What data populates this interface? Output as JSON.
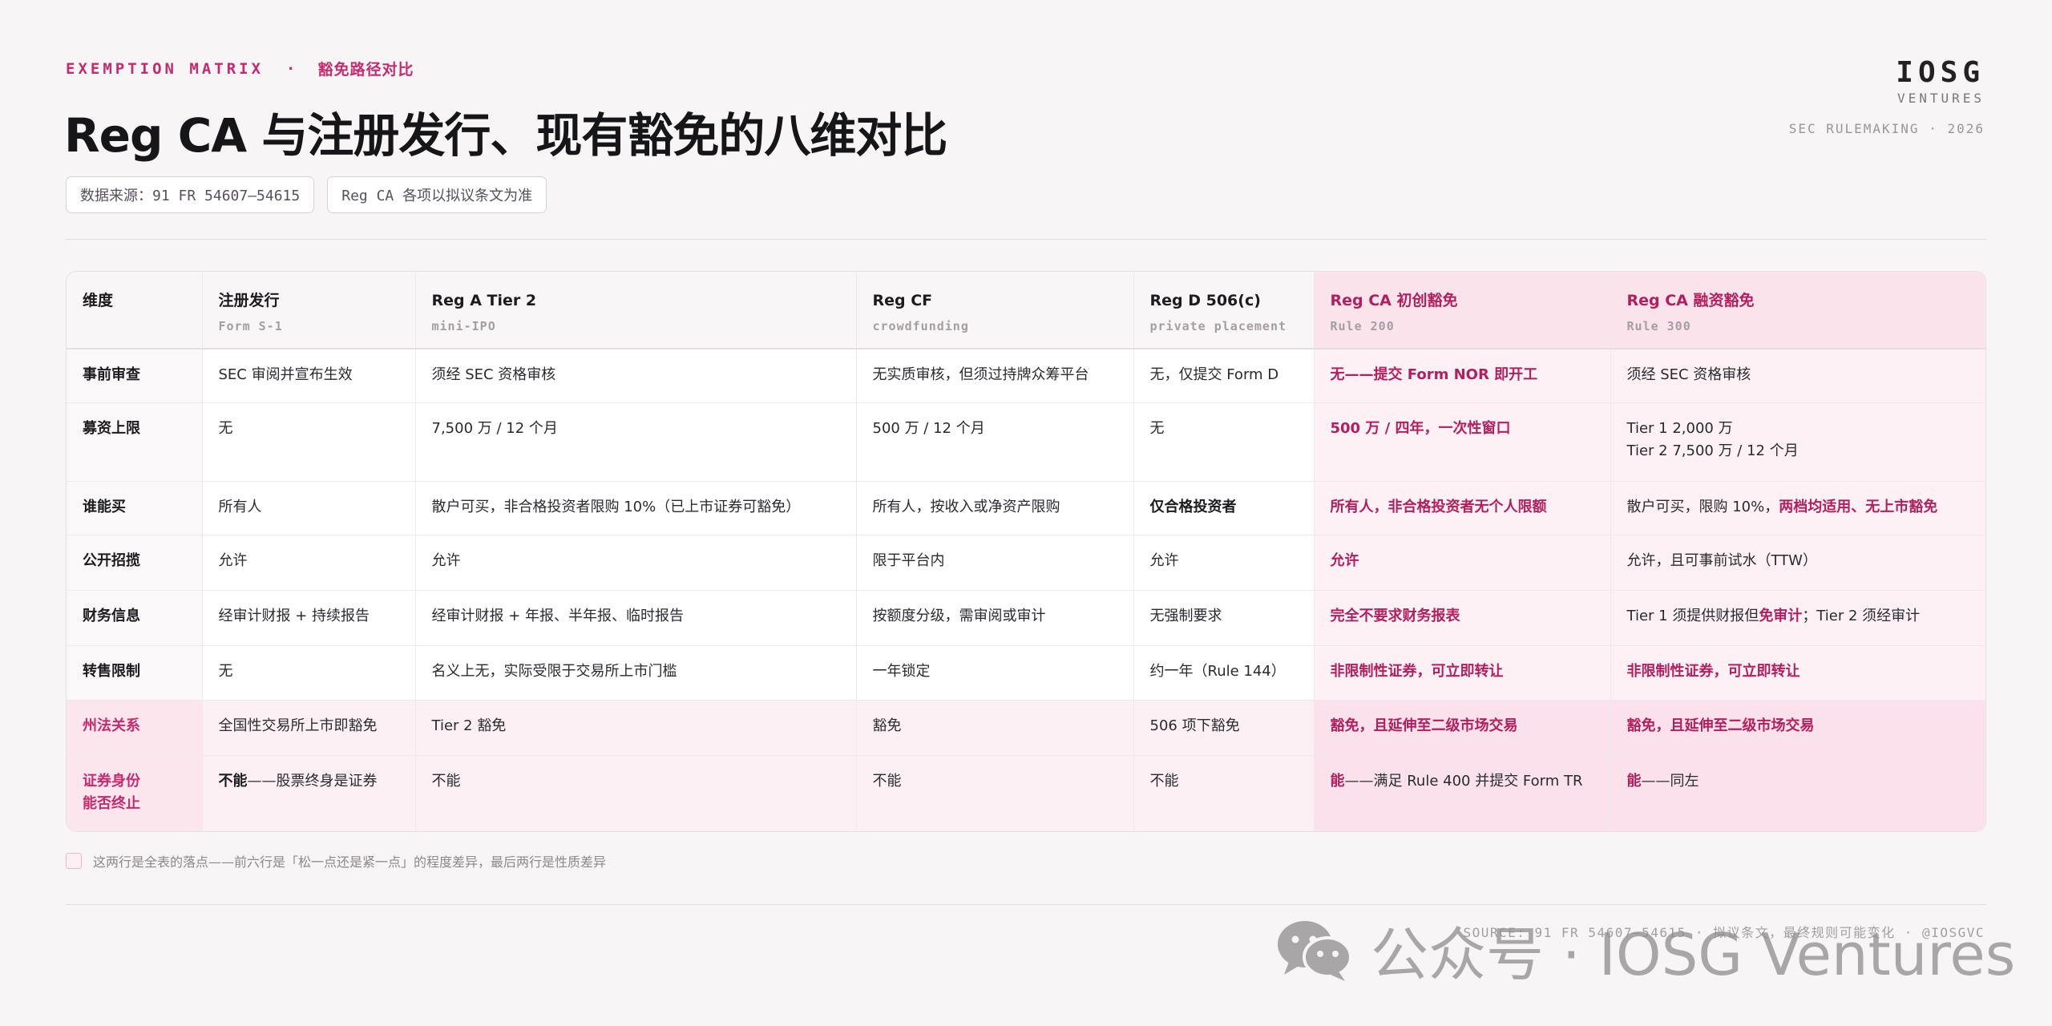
{
  "header": {
    "eyebrow_en": "EXEMPTION MATRIX",
    "eyebrow_dot": "·",
    "eyebrow_cn": "豁免路径对比",
    "title": "Reg CA 与注册发行、现有豁免的八维对比",
    "chips": [
      "数据来源：91 FR 54607–54615",
      "Reg CA 各项以拟议条文为准"
    ]
  },
  "brand": {
    "logo": "IOSG",
    "sub": "VENTURES",
    "meta": "SEC RULEMAKING · 2026"
  },
  "table": {
    "columns": [
      {
        "title": "维度",
        "sub": ""
      },
      {
        "title": "注册发行",
        "sub": "Form S-1"
      },
      {
        "title": "Reg A Tier 2",
        "sub": "mini-IPO"
      },
      {
        "title": "Reg CF",
        "sub": "crowdfunding"
      },
      {
        "title": "Reg D 506(c)",
        "sub": "private placement"
      },
      {
        "title": "Reg CA 初创豁免",
        "sub": "Rule 200"
      },
      {
        "title": "Reg CA 融资豁免",
        "sub": "Rule 300"
      }
    ],
    "rows": [
      {
        "dim": "事前审查",
        "cells": [
          "SEC 审阅并宣布生效",
          "须经 SEC 资格审核",
          "无实质审核，但须过持牌众筹平台",
          "无，仅提交 Form D",
          "无——提交 Form NOR 即开工",
          "须经 SEC 资格审核"
        ]
      },
      {
        "dim": "募资上限",
        "cells": [
          "无",
          "7,500 万 / 12 个月",
          "500 万 / 12 个月",
          "无",
          "500 万 / 四年，一次性窗口",
          "Tier 1 2,000 万",
          "Tier 2 7,500 万 / 12 个月"
        ]
      },
      {
        "dim": "谁能买",
        "cells": [
          "所有人",
          "散户可买，非合格投资者限购 10%（已上市证券可豁免）",
          "所有人，按收入或净资产限购",
          "仅合格投资者",
          "所有人，非合格投资者无个人限额",
          "散户可买，限购 10%，",
          "两档均适用、无上市豁免"
        ]
      },
      {
        "dim": "公开招揽",
        "cells": [
          "允许",
          "允许",
          "限于平台内",
          "允许",
          "允许",
          "允许，且可事前试水（TTW）"
        ]
      },
      {
        "dim": "财务信息",
        "cells": [
          "经审计财报 + 持续报告",
          "经审计财报 + 年报、半年报、临时报告",
          "按额度分级，需审阅或审计",
          "无强制要求",
          "完全不要求财务报表",
          "Tier 1 须提供财报但",
          "免审计",
          "；Tier 2 须经审计"
        ]
      },
      {
        "dim": "转售限制",
        "cells": [
          "无",
          "名义上无，实际受限于交易所上市门槛",
          "一年锁定",
          "约一年（Rule 144）",
          "非限制性证券，可立即转让",
          "非限制性证券，可立即转让"
        ]
      },
      {
        "dim": "州法关系",
        "cells": [
          "全国性交易所上市即豁免",
          "Tier 2 豁免",
          "豁免",
          "506 项下豁免",
          "豁免，且延伸至二级市场交易",
          "豁免，且延伸至二级市场交易"
        ]
      },
      {
        "dim_1": "证券身份",
        "dim_2": "能否终止",
        "cells": [
          "不能",
          "——股票终身是证券",
          "不能",
          "不能",
          "不能",
          "能",
          "——满足 Rule 400 并提交 Form TR",
          "能",
          "——同左"
        ]
      }
    ]
  },
  "note": "这两行是全表的落点——前六行是「松一点还是紧一点」的程度差异，最后两行是性质差异",
  "footer": {
    "source": "SOURCE: 91 FR 54607–54615 · 拟议条文，最终规则可能变化 · @IOSGVC"
  },
  "watermark": {
    "icon": "wechat-icon",
    "text": "公众号 · IOSG Ventures"
  },
  "colors": {
    "accent": "#c62a6e",
    "highlight_bg": "#fdf1f5",
    "page_bg": "#f7f5f6"
  }
}
